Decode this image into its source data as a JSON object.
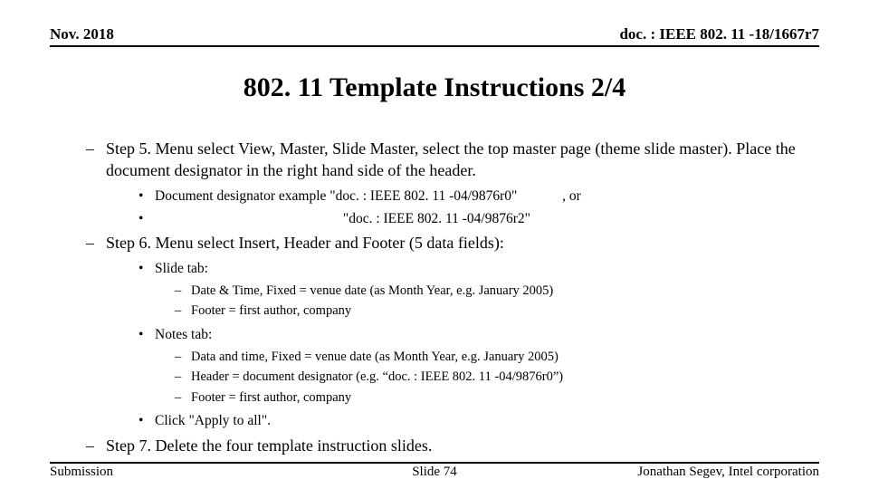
{
  "header": {
    "left": "Nov. 2018",
    "right": "doc. : IEEE 802. 11 -18/1667r7"
  },
  "title": "802. 11 Template Instructions 2/4",
  "steps": {
    "step5": "Step 5. Menu select View, Master, Slide Master, select the top master page (theme slide master).  Place the document designator in the right hand side of the header.",
    "step5_sub": {
      "line1_pre": "Document designator example \"doc. : IEEE 802. 11 -04/9876r0\"",
      "line1_post": ", or",
      "line2": "\"doc. : IEEE 802. 11 -04/9876r2\""
    },
    "step6": "Step 6. Menu select Insert, Header and Footer (5 data fields):",
    "step6_slide_tab": "Slide tab:",
    "step6_slide_items": {
      "a": "Date & Time, Fixed =  venue date (as Month Year, e.g. January 2005)",
      "b": "Footer = first author, company"
    },
    "step6_notes_tab": "Notes tab:",
    "step6_notes_items": {
      "a": "Data and time, Fixed = venue date (as Month Year, e.g. January 2005)",
      "b": "Header = document designator (e.g. “doc. : IEEE 802. 11 -04/9876r0”)",
      "c": "Footer = first author, company"
    },
    "step6_apply": "Click \"Apply to all\".",
    "step7": "Step 7. Delete the four template instruction slides."
  },
  "footer": {
    "left": "Submission",
    "center": "Slide 74",
    "right": "Jonathan Segev, Intel corporation"
  }
}
